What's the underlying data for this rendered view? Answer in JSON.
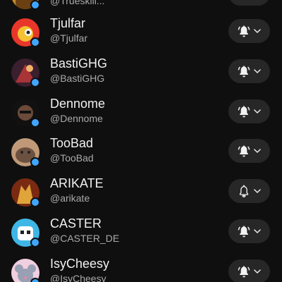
{
  "channels": [
    {
      "name": "",
      "handle": "@Trueskill...",
      "bell": "filled",
      "avatar_colors": [
        "#c58a2a",
        "#6b3f12"
      ]
    },
    {
      "name": "Tjulfar",
      "handle": "@Tjulfar",
      "bell": "filled",
      "avatar_colors": [
        "#e8372a",
        "#f4c232"
      ]
    },
    {
      "name": "BastiGHG",
      "handle": "@BastiGHG",
      "bell": "filled",
      "avatar_colors": [
        "#3a1f2e",
        "#c43a3a"
      ]
    },
    {
      "name": "Dennome",
      "handle": "@Dennome",
      "bell": "filled",
      "avatar_colors": [
        "#111111",
        "#6b4a3a"
      ]
    },
    {
      "name": "TooBad",
      "handle": "@TooBad",
      "bell": "filled",
      "avatar_colors": [
        "#c09a78",
        "#6d5140"
      ]
    },
    {
      "name": "ARIKATE",
      "handle": "@arikate",
      "bell": "outline",
      "avatar_colors": [
        "#7a2a12",
        "#e0a43a"
      ]
    },
    {
      "name": "CASTER",
      "handle": "@CASTER_DE",
      "bell": "filled",
      "avatar_colors": [
        "#3fb7e6",
        "#ffffff"
      ]
    },
    {
      "name": "IsyCheesy",
      "handle": "@IsyCheesy",
      "bell": "filled",
      "avatar_colors": [
        "#f0cfe0",
        "#9aa0b3"
      ]
    }
  ],
  "colors": {
    "background": "#0f0f0f",
    "button_bg": "#272727",
    "live_dot": "#3ea6ff",
    "name_text": "#f1f1f1",
    "handle_text": "#aaaaaa"
  },
  "icons": {
    "bell_filled": "bell-ring-icon",
    "bell_outline": "bell-outline-icon",
    "chevron": "chevron-down-icon"
  }
}
